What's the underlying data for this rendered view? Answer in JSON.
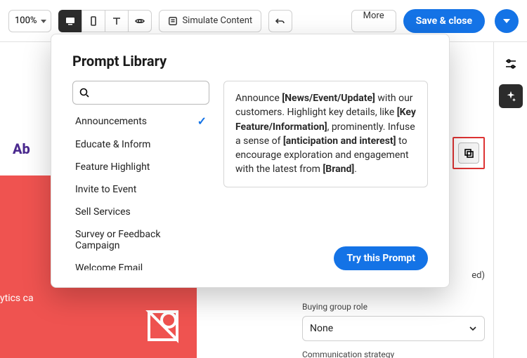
{
  "toolbar": {
    "zoom_label": "100%",
    "simulate_label": "Simulate Content",
    "more_label": "More",
    "save_close_label": "Save & close"
  },
  "canvas": {
    "title_fragment": "Ab",
    "subtitle_fragment": "ytics ca"
  },
  "properties": {
    "text_ed_fragment": "ed)",
    "buying_group_label": "Buying group role",
    "buying_group_value": "None",
    "comm_strategy_label": "Communication strategy"
  },
  "modal": {
    "title": "Prompt Library",
    "search_placeholder": "",
    "selected_index": 0,
    "items": [
      "Announcements",
      "Educate & Inform",
      "Feature Highlight",
      "Invite to Event",
      "Sell Services",
      "Survey or Feedback Campaign",
      "Welcome Email"
    ],
    "preview": {
      "t1": "Announce ",
      "b1": "[News/Event/Update]",
      "t2": " with our customers. Highlight key details, like ",
      "b2": "[Key Feature/Information]",
      "t3": ", prominently. Infuse a sense of ",
      "b3": "[anticipation and interest]",
      "t4": " to encourage exploration and engagement with the latest from ",
      "b4": "[Brand]",
      "t5": "."
    },
    "try_label": "Try this Prompt"
  }
}
